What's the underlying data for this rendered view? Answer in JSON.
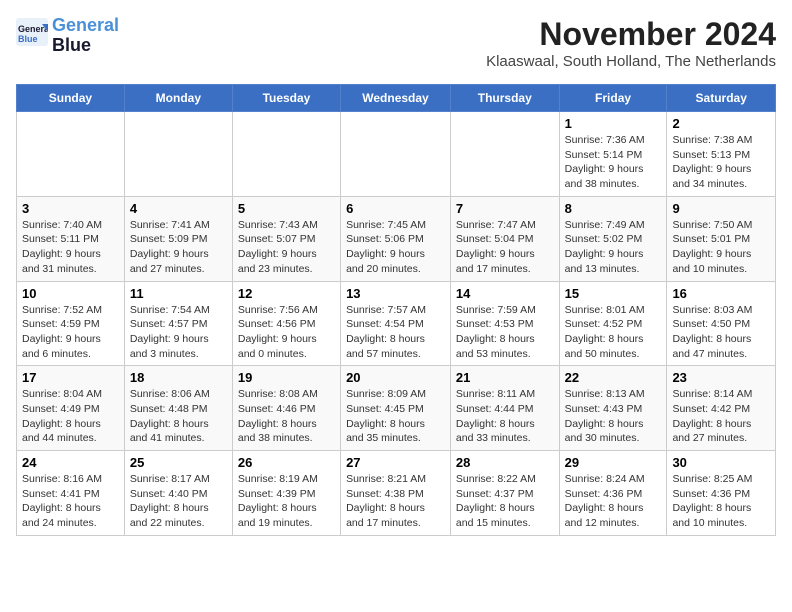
{
  "header": {
    "logo_line1": "General",
    "logo_line2": "Blue",
    "title": "November 2024",
    "subtitle": "Klaaswaal, South Holland, The Netherlands"
  },
  "days_of_week": [
    "Sunday",
    "Monday",
    "Tuesday",
    "Wednesday",
    "Thursday",
    "Friday",
    "Saturday"
  ],
  "weeks": [
    [
      {
        "day": "",
        "info": ""
      },
      {
        "day": "",
        "info": ""
      },
      {
        "day": "",
        "info": ""
      },
      {
        "day": "",
        "info": ""
      },
      {
        "day": "",
        "info": ""
      },
      {
        "day": "1",
        "info": "Sunrise: 7:36 AM\nSunset: 5:14 PM\nDaylight: 9 hours and 38 minutes."
      },
      {
        "day": "2",
        "info": "Sunrise: 7:38 AM\nSunset: 5:13 PM\nDaylight: 9 hours and 34 minutes."
      }
    ],
    [
      {
        "day": "3",
        "info": "Sunrise: 7:40 AM\nSunset: 5:11 PM\nDaylight: 9 hours and 31 minutes."
      },
      {
        "day": "4",
        "info": "Sunrise: 7:41 AM\nSunset: 5:09 PM\nDaylight: 9 hours and 27 minutes."
      },
      {
        "day": "5",
        "info": "Sunrise: 7:43 AM\nSunset: 5:07 PM\nDaylight: 9 hours and 23 minutes."
      },
      {
        "day": "6",
        "info": "Sunrise: 7:45 AM\nSunset: 5:06 PM\nDaylight: 9 hours and 20 minutes."
      },
      {
        "day": "7",
        "info": "Sunrise: 7:47 AM\nSunset: 5:04 PM\nDaylight: 9 hours and 17 minutes."
      },
      {
        "day": "8",
        "info": "Sunrise: 7:49 AM\nSunset: 5:02 PM\nDaylight: 9 hours and 13 minutes."
      },
      {
        "day": "9",
        "info": "Sunrise: 7:50 AM\nSunset: 5:01 PM\nDaylight: 9 hours and 10 minutes."
      }
    ],
    [
      {
        "day": "10",
        "info": "Sunrise: 7:52 AM\nSunset: 4:59 PM\nDaylight: 9 hours and 6 minutes."
      },
      {
        "day": "11",
        "info": "Sunrise: 7:54 AM\nSunset: 4:57 PM\nDaylight: 9 hours and 3 minutes."
      },
      {
        "day": "12",
        "info": "Sunrise: 7:56 AM\nSunset: 4:56 PM\nDaylight: 9 hours and 0 minutes."
      },
      {
        "day": "13",
        "info": "Sunrise: 7:57 AM\nSunset: 4:54 PM\nDaylight: 8 hours and 57 minutes."
      },
      {
        "day": "14",
        "info": "Sunrise: 7:59 AM\nSunset: 4:53 PM\nDaylight: 8 hours and 53 minutes."
      },
      {
        "day": "15",
        "info": "Sunrise: 8:01 AM\nSunset: 4:52 PM\nDaylight: 8 hours and 50 minutes."
      },
      {
        "day": "16",
        "info": "Sunrise: 8:03 AM\nSunset: 4:50 PM\nDaylight: 8 hours and 47 minutes."
      }
    ],
    [
      {
        "day": "17",
        "info": "Sunrise: 8:04 AM\nSunset: 4:49 PM\nDaylight: 8 hours and 44 minutes."
      },
      {
        "day": "18",
        "info": "Sunrise: 8:06 AM\nSunset: 4:48 PM\nDaylight: 8 hours and 41 minutes."
      },
      {
        "day": "19",
        "info": "Sunrise: 8:08 AM\nSunset: 4:46 PM\nDaylight: 8 hours and 38 minutes."
      },
      {
        "day": "20",
        "info": "Sunrise: 8:09 AM\nSunset: 4:45 PM\nDaylight: 8 hours and 35 minutes."
      },
      {
        "day": "21",
        "info": "Sunrise: 8:11 AM\nSunset: 4:44 PM\nDaylight: 8 hours and 33 minutes."
      },
      {
        "day": "22",
        "info": "Sunrise: 8:13 AM\nSunset: 4:43 PM\nDaylight: 8 hours and 30 minutes."
      },
      {
        "day": "23",
        "info": "Sunrise: 8:14 AM\nSunset: 4:42 PM\nDaylight: 8 hours and 27 minutes."
      }
    ],
    [
      {
        "day": "24",
        "info": "Sunrise: 8:16 AM\nSunset: 4:41 PM\nDaylight: 8 hours and 24 minutes."
      },
      {
        "day": "25",
        "info": "Sunrise: 8:17 AM\nSunset: 4:40 PM\nDaylight: 8 hours and 22 minutes."
      },
      {
        "day": "26",
        "info": "Sunrise: 8:19 AM\nSunset: 4:39 PM\nDaylight: 8 hours and 19 minutes."
      },
      {
        "day": "27",
        "info": "Sunrise: 8:21 AM\nSunset: 4:38 PM\nDaylight: 8 hours and 17 minutes."
      },
      {
        "day": "28",
        "info": "Sunrise: 8:22 AM\nSunset: 4:37 PM\nDaylight: 8 hours and 15 minutes."
      },
      {
        "day": "29",
        "info": "Sunrise: 8:24 AM\nSunset: 4:36 PM\nDaylight: 8 hours and 12 minutes."
      },
      {
        "day": "30",
        "info": "Sunrise: 8:25 AM\nSunset: 4:36 PM\nDaylight: 8 hours and 10 minutes."
      }
    ]
  ]
}
